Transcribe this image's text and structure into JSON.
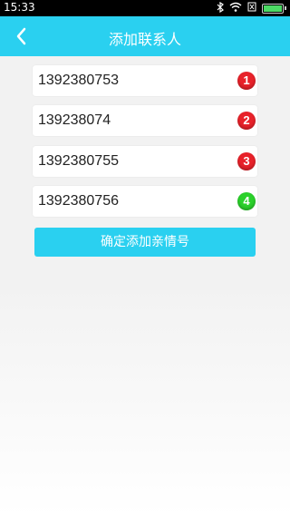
{
  "status_bar": {
    "time": "15:33",
    "icons": [
      "bluetooth-icon",
      "wifi-icon",
      "no-sim-icon",
      "battery-icon"
    ],
    "battery_level": 1.0
  },
  "header": {
    "back_icon": "chevron-left-icon",
    "title": "添加联系人",
    "background_color": "#2ad0f0"
  },
  "contacts": [
    {
      "value": "1392380753",
      "badge": "1",
      "badge_color": "#e8222a"
    },
    {
      "value": "139238074",
      "badge": "2",
      "badge_color": "#e8222a"
    },
    {
      "value": "1392380755",
      "badge": "3",
      "badge_color": "#e8222a"
    },
    {
      "value": "1392380756",
      "badge": "4",
      "badge_color": "#2bd12b"
    }
  ],
  "confirm_button": {
    "label": "确定添加亲情号"
  }
}
